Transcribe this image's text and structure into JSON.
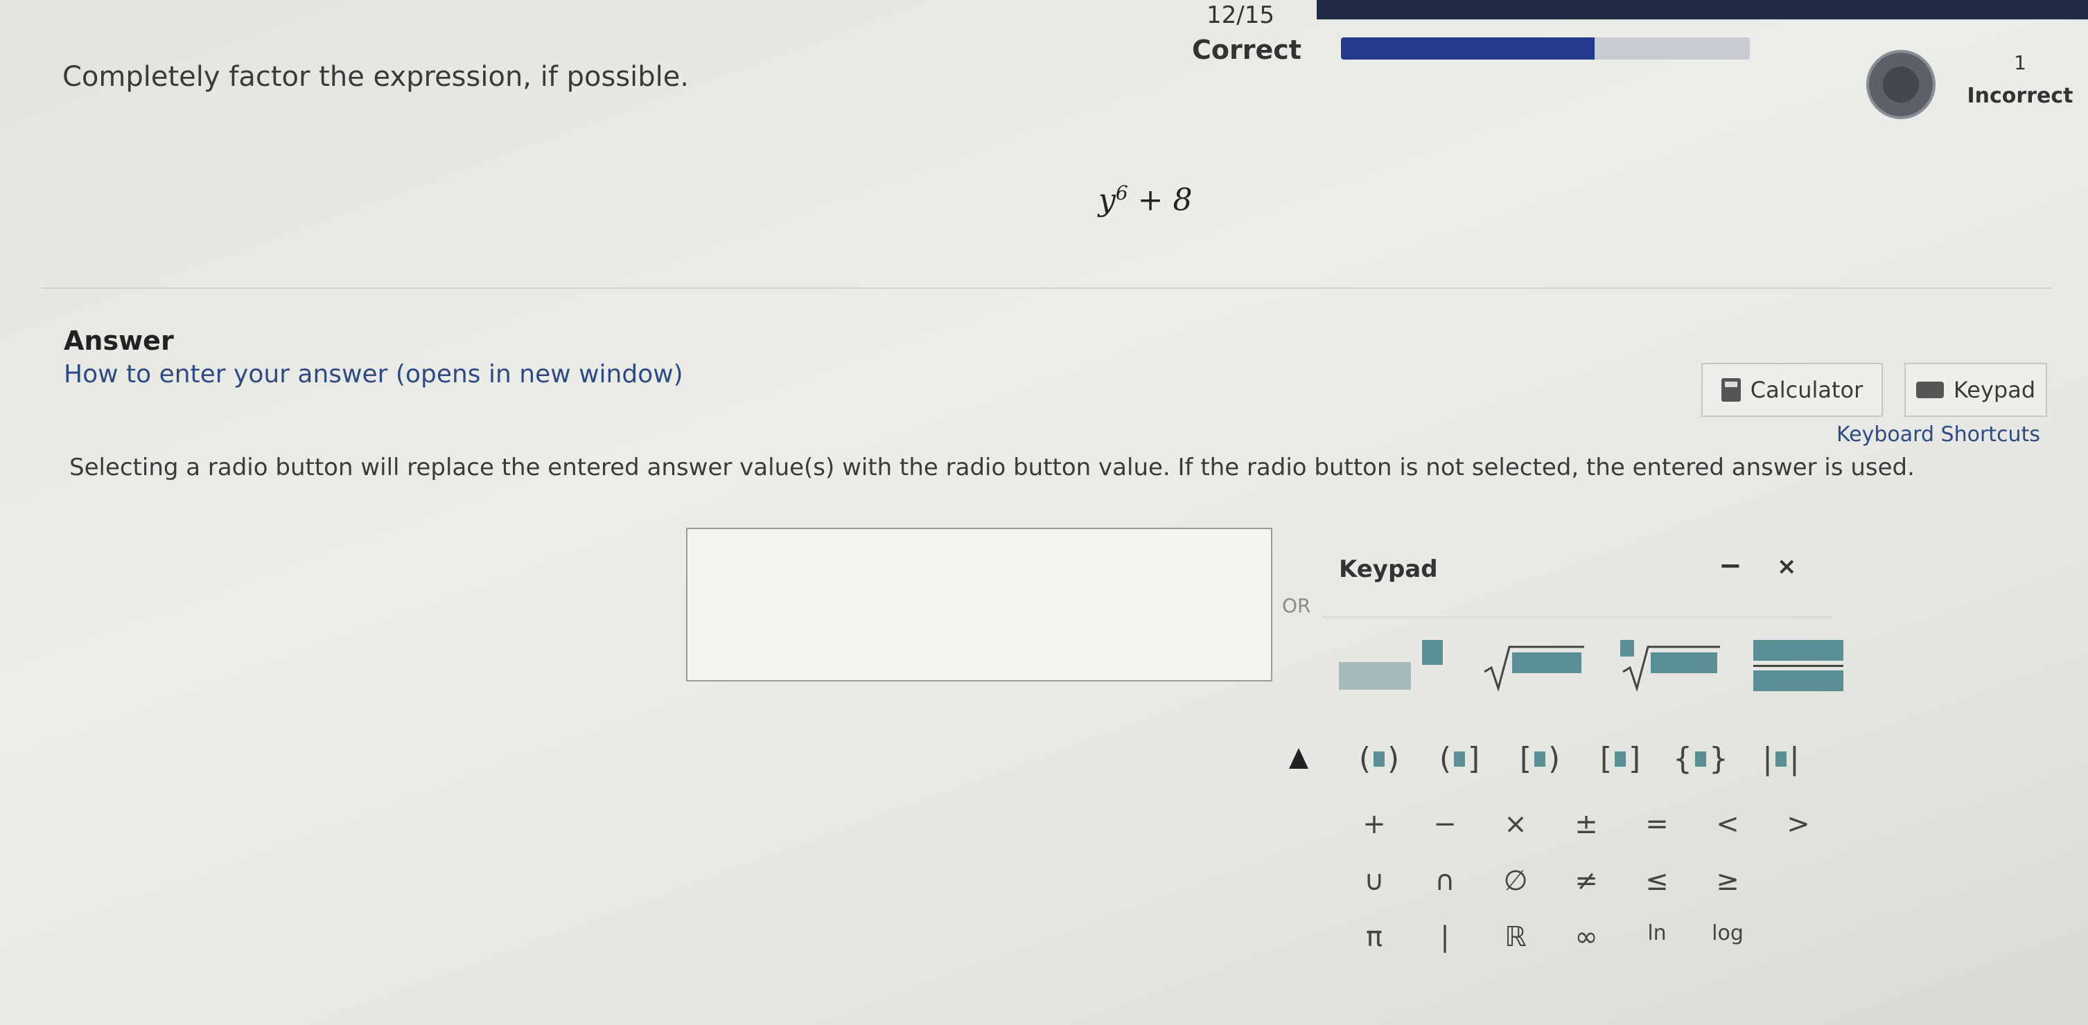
{
  "header": {
    "correct_count": "12/15",
    "correct_label": "Correct",
    "progress_fraction": 0.62,
    "incorrect_count": "1",
    "incorrect_label": "Incorrect"
  },
  "question": {
    "prompt": "Completely factor the expression, if possible.",
    "expression_base": "y",
    "expression_exponent": "6",
    "expression_rest": " + 8"
  },
  "answer": {
    "title": "Answer",
    "howto_link": "How to enter your answer (opens in new window)",
    "calculator_label": "Calculator",
    "keypad_label": "Keypad",
    "shortcuts_link": "Keyboard Shortcuts",
    "notice": "Selecting a radio button will replace the entered answer value(s) with the radio button value. If the radio button is not selected, the entered answer is used.",
    "or_label": "OR",
    "input_value": ""
  },
  "keypad": {
    "title": "Keypad",
    "minimize": "−",
    "close": "×",
    "brackets": [
      "( )",
      "( ]",
      "[ )",
      "[ ]",
      "{ }",
      "|  |"
    ],
    "operators": [
      "+",
      "−",
      "×",
      "±",
      "=",
      "<",
      ">"
    ],
    "sets": [
      "∪",
      "∩",
      "∅",
      "≠",
      "≤",
      "≥"
    ],
    "symbols": [
      "π",
      "|",
      "ℝ",
      "∞",
      "ln",
      "log"
    ]
  }
}
